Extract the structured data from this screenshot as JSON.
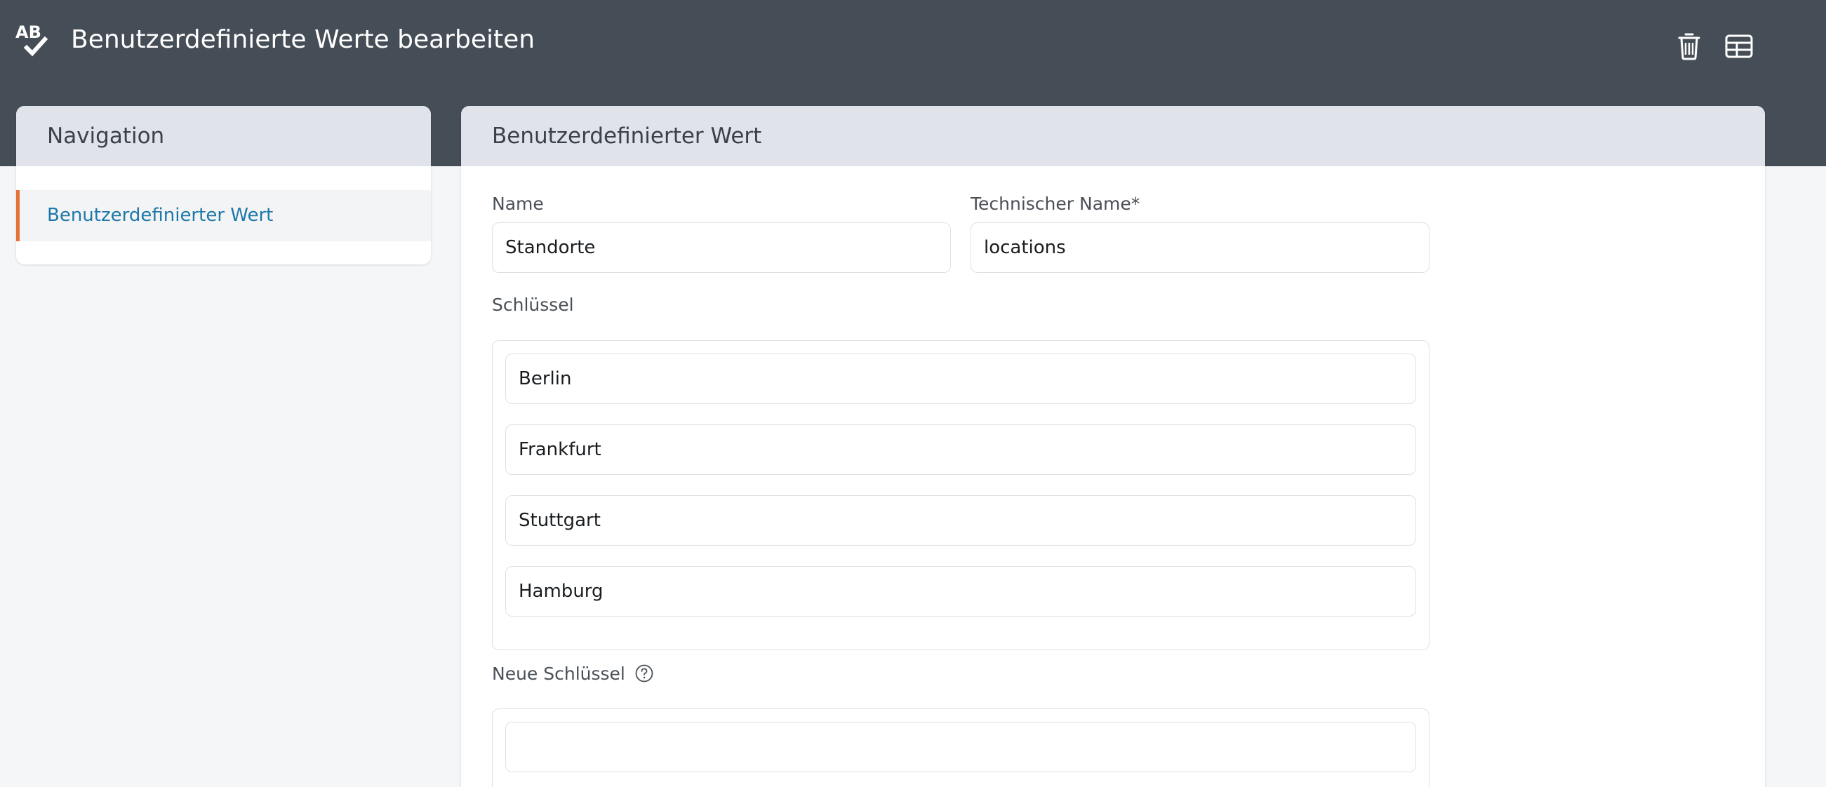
{
  "header": {
    "title": "Benutzerdefinierte Werte bearbeiten",
    "app_icon": "ab-check-icon",
    "actions": [
      {
        "icon": "trash-icon"
      },
      {
        "icon": "table-icon"
      }
    ]
  },
  "navigation": {
    "title": "Navigation",
    "items": [
      {
        "label": "Benutzerdefinierter Wert",
        "active": true
      }
    ]
  },
  "form": {
    "title": "Benutzerdefinierter Wert",
    "name_label": "Name",
    "name_value": "Standorte",
    "technical_name_label": "Technischer Name*",
    "technical_name_value": "locations",
    "keys_label": "Schlüssel",
    "keys": [
      "Berlin",
      "Frankfurt",
      "Stuttgart",
      "Hamburg"
    ],
    "new_keys_label": "Neue Schlüssel",
    "new_keys_value": ""
  },
  "colors": {
    "topbar": "#454d56",
    "accent": "#e8733a",
    "link": "#1f78a8",
    "card_header": "#e0e4ea"
  }
}
